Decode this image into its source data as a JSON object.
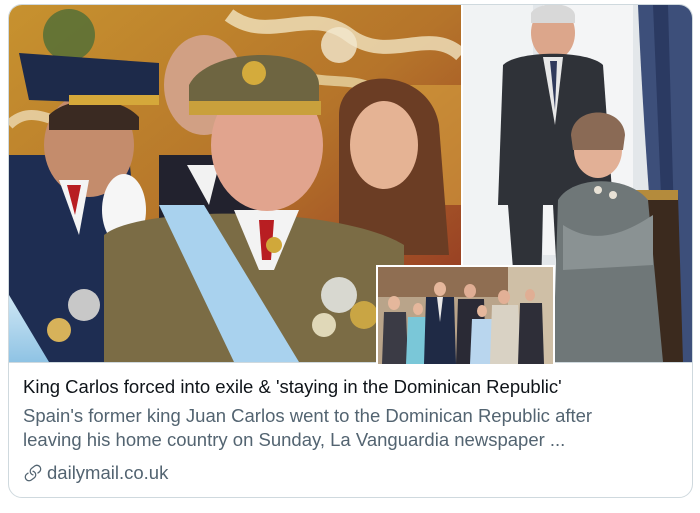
{
  "card": {
    "title": "King Carlos forced into exile & 'staying in the Dominican Republic'",
    "description_line1": "Spain's former king Juan Carlos went to the Dominican Republic after",
    "description_line2": "leaving his home country on Sunday, La Vanguardia newspaper ...",
    "source": "dailymail.co.uk",
    "source_icon": "link-icon"
  },
  "colors": {
    "border": "#cfd9de",
    "title": "#0f1419",
    "secondary_text": "#536471"
  }
}
